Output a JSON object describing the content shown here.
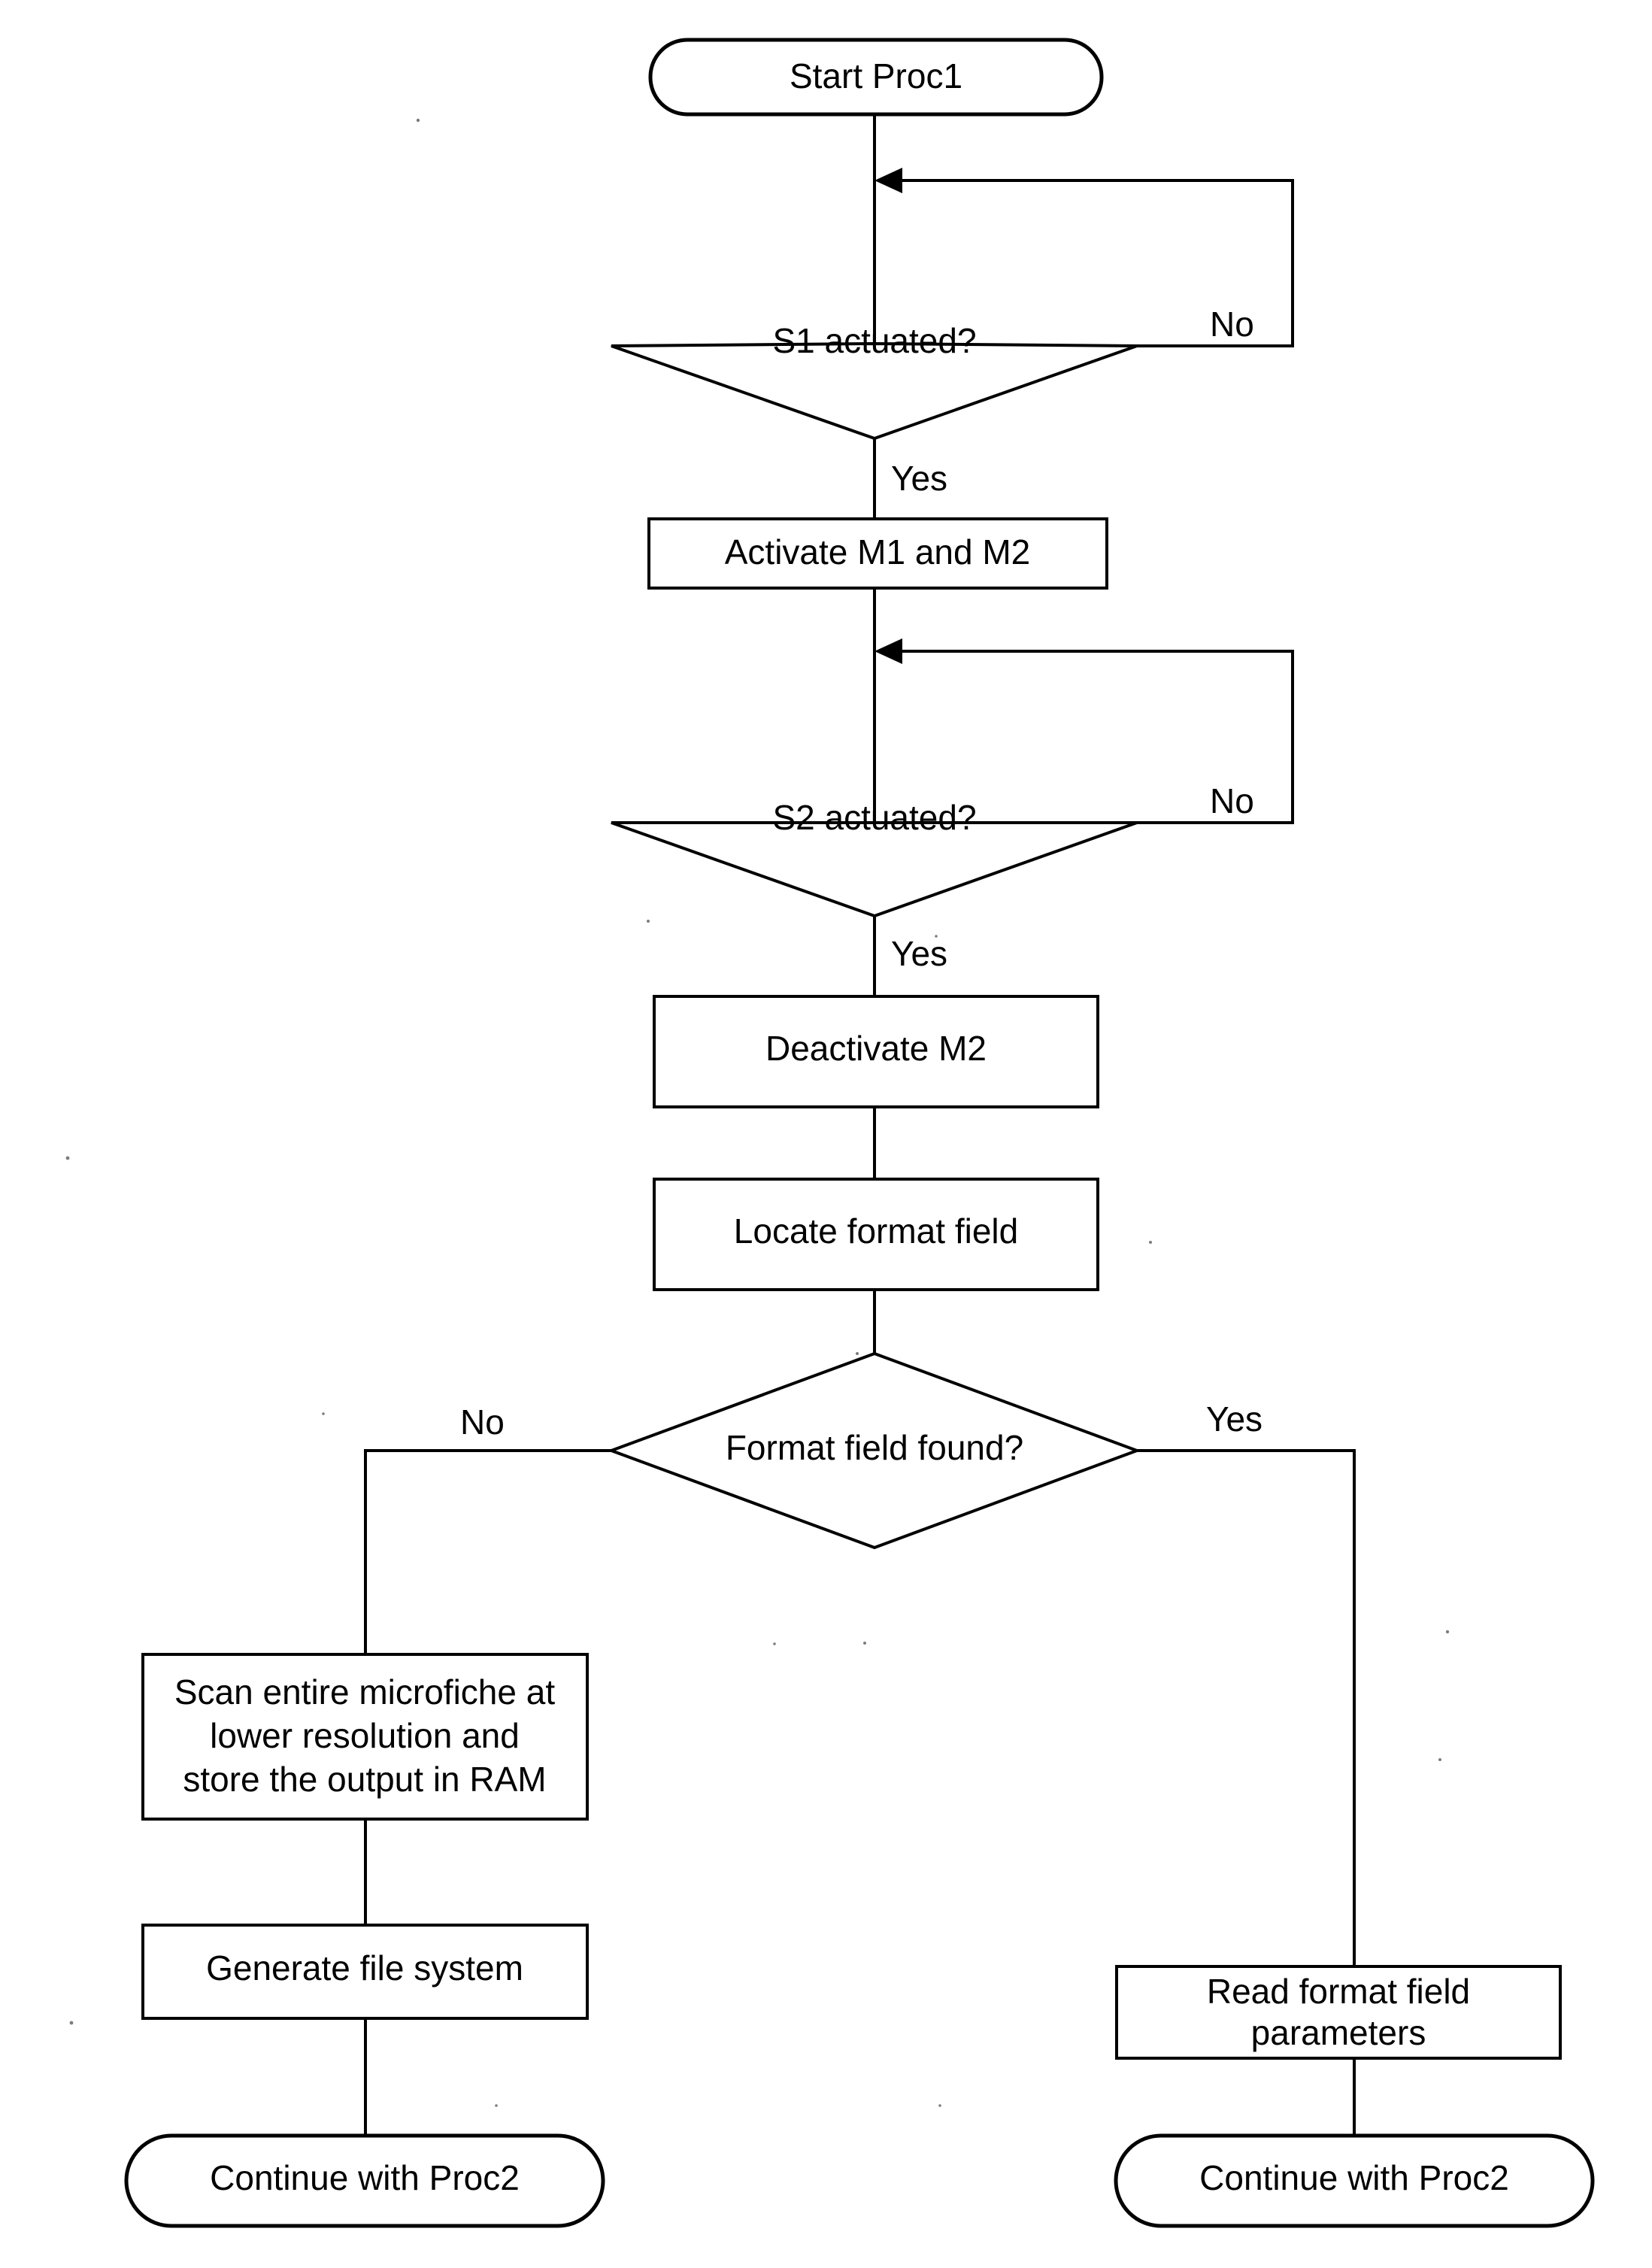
{
  "diagram": {
    "type": "flowchart",
    "title": "Proc1 microfiche scanning flowchart",
    "orientation": "top-to-bottom",
    "background_color": "#ffffff",
    "line_color": "#000000",
    "text_color": "#000000"
  },
  "nodes": {
    "start": {
      "shape": "terminator",
      "label": "Start Proc1"
    },
    "decision_s1": {
      "shape": "decision",
      "label": "S1 actuated?"
    },
    "activate_m1_m2": {
      "shape": "process",
      "label": "Activate M1 and M2"
    },
    "decision_s2": {
      "shape": "decision",
      "label": "S2 actuated?"
    },
    "deactivate_m2": {
      "shape": "process",
      "label": "Deactivate M2"
    },
    "locate_format_field": {
      "shape": "process",
      "label": "Locate format field"
    },
    "decision_format_found": {
      "shape": "decision",
      "label": "Format field found?"
    },
    "scan_microfiche": {
      "shape": "process",
      "label_line1": "Scan entire microfiche at",
      "label_line2": "lower resolution and",
      "label_line3": "store the output in RAM"
    },
    "generate_file_system": {
      "shape": "process",
      "label": "Generate file system"
    },
    "read_format_params": {
      "shape": "process",
      "label_line1": "Read format field",
      "label_line2": "parameters"
    },
    "continue_proc2_left": {
      "shape": "terminator",
      "label": "Continue with Proc2"
    },
    "continue_proc2_right": {
      "shape": "terminator",
      "label": "Continue with Proc2"
    }
  },
  "edge_labels": {
    "s1_no": "No",
    "s1_yes": "Yes",
    "s2_no": "No",
    "s2_yes": "Yes",
    "format_no": "No",
    "format_yes": "Yes"
  }
}
